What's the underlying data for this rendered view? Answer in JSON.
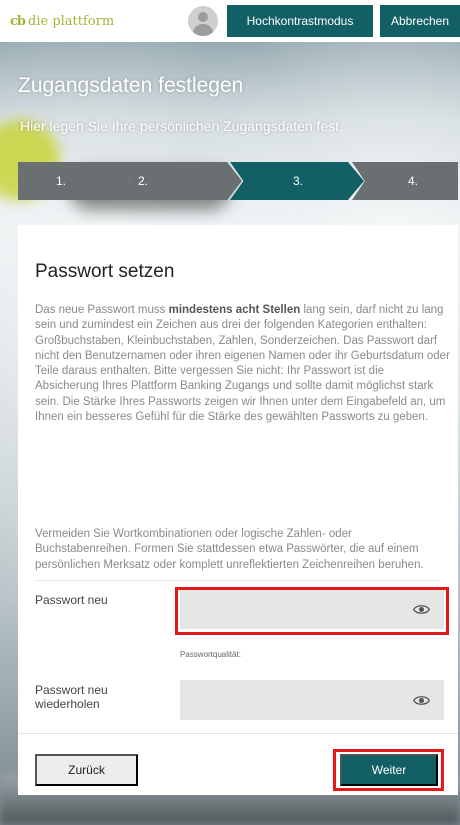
{
  "brand": {
    "logo_mark": "cb",
    "logo_text": "die plattform"
  },
  "header": {
    "contrast_button": "Hochkontrastmodus",
    "cancel_button": "Abbrechen"
  },
  "page": {
    "title": "Zugangsdaten festlegen",
    "subtitle": "Hier legen Sie Ihre persönlichen Zugangsdaten fest."
  },
  "steps": [
    {
      "label": "1."
    },
    {
      "label": "2."
    },
    {
      "label": "3.",
      "active": true
    },
    {
      "label": "4."
    }
  ],
  "card": {
    "title": "Passwort setzen",
    "desc_intro": "Das neue Passwort muss ",
    "desc_bold": "mindestens acht Stellen",
    "desc_rest": " lang sein, darf nicht zu lang sein und zumindest ein Zeichen aus drei der folgenden Kategorien enthalten: Großbuchstaben, Kleinbuchstaben, Zahlen, Sonderzeichen. Das Passwort darf nicht den Benutzernamen oder ihren eigenen Namen oder ihr Geburtsdatum oder Teile daraus enthalten. Bitte vergessen Sie nicht: Ihr Passwort ist die Absicherung Ihres Plattform Banking Zugangs und sollte damit möglichst stark sein. Die Stärke Ihres Passworts zeigen wir Ihnen unter dem Eingabefeld an, um Ihnen ein besseres Gefühl für die Stärke des gewählten Passworts zu geben.",
    "desc2": "Vermeiden Sie Wortkombinationen oder logische Zahlen- oder Buchstabenreihen. Formen Sie stattdessen etwa Passwörter, die auf einem persönlichen Merksatz oder komplett unreflektierten Zeichenreihen beruhen.",
    "field_new_label": "Passwort neu",
    "field_new_value": "",
    "quality_label": "Passwortqualität:",
    "field_repeat_label": "Passwort neu wiederholen",
    "field_repeat_value": "",
    "back_button": "Zurück",
    "next_button": "Weiter"
  },
  "icons": {
    "show_password": "eye-icon",
    "user": "avatar-icon"
  },
  "colors": {
    "primary": "#125f66",
    "step_inactive": "#6a6f71",
    "highlight": "#e41818",
    "brand": "#a7b43a"
  }
}
